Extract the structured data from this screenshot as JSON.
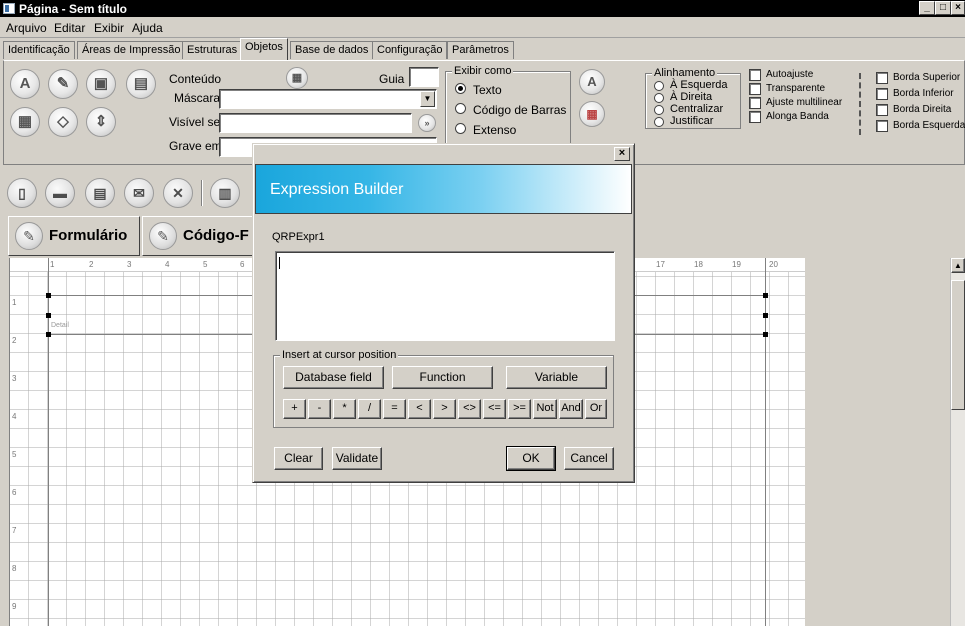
{
  "window": {
    "title": "Página - Sem título",
    "minimize": "_",
    "maximize": "□",
    "close": "×"
  },
  "menu": [
    "Arquivo",
    "Editar",
    "Exibir",
    "Ajuda"
  ],
  "tabs": [
    "Identificação",
    "Áreas de Impressão",
    "Estruturas",
    "Objetos",
    "Base de dados",
    "Configuração",
    "Parâmetros"
  ],
  "active_tab": "Objetos",
  "props": {
    "conteudo_label": "Conteúdo",
    "guia_label": "Guia",
    "mascara_label": "Máscara",
    "visivel_label": "Visível se",
    "grave_label": "Grave em",
    "exibir_como": {
      "legend": "Exibir como",
      "options": [
        "Texto",
        "Código de Barras",
        "Extenso"
      ],
      "selected": "Texto"
    },
    "alinhamento": {
      "legend": "Alinhamento",
      "options": [
        "À Esquerda",
        "À Direita",
        "Centralizar",
        "Justificar"
      ]
    },
    "checks": [
      "Autoajuste",
      "Transparente",
      "Ajuste multilinear",
      "Alonga Banda"
    ],
    "bordas": [
      "Borda Superior",
      "Borda Inferior",
      "Borda Direita",
      "Borda Esquerda"
    ]
  },
  "icons": {
    "panel": [
      "text-icon",
      "pen-icon",
      "computer-icon",
      "image-icon",
      "calculator-icon",
      "shapes-icon",
      "updown-icon"
    ],
    "toolbar": [
      "new-file-icon",
      "open-folder-icon",
      "save-icon",
      "mail-icon",
      "close-icon",
      "print-icon"
    ]
  },
  "bigtabs": [
    "Formulário",
    "Código-F"
  ],
  "canvas": {
    "ruler_numbers": [
      "1",
      "2",
      "3",
      "4",
      "5",
      "6",
      "17",
      "18",
      "19",
      "20"
    ],
    "side_numbers": [
      "1",
      "2",
      "3",
      "4",
      "5",
      "6",
      "7",
      "8",
      "9"
    ],
    "band_label": "Detail"
  },
  "dialog": {
    "title": "Expression Builder",
    "close": "×",
    "expr_name": "QRPExpr1",
    "group_legend": "Insert at cursor position",
    "insert_buttons": [
      "Database field",
      "Function",
      "Variable"
    ],
    "operators": [
      "+",
      "-",
      "*",
      "/",
      "=",
      "<",
      ">",
      "<>",
      "<=",
      ">=",
      "Not",
      "And",
      "Or"
    ],
    "clear": "Clear",
    "validate": "Validate",
    "ok": "OK",
    "cancel": "Cancel"
  }
}
